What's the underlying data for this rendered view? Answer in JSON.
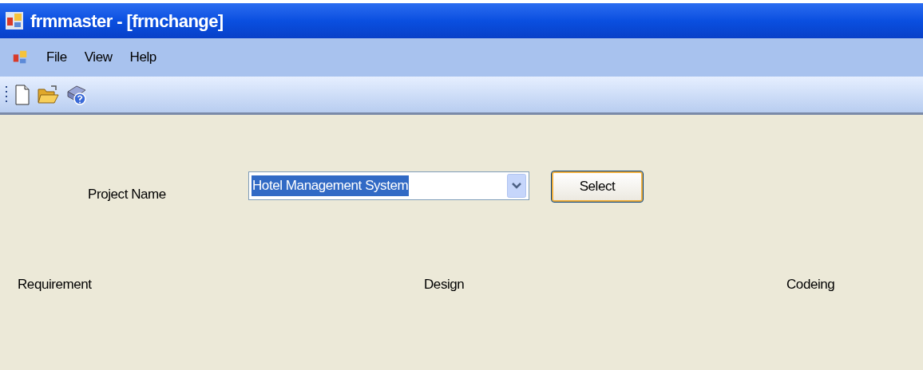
{
  "window": {
    "title": "frmmaster - [frmchange]"
  },
  "menu": [
    {
      "label": "File"
    },
    {
      "label": "View"
    },
    {
      "label": "Help"
    }
  ],
  "toolbar": [
    {
      "kind": "new"
    },
    {
      "kind": "open"
    },
    {
      "kind": "help"
    }
  ],
  "form": {
    "project_label": "Project Name",
    "project_combo": {
      "value": "Hotel Management System",
      "text_selected": true
    },
    "select_button": {
      "label": "Select",
      "focused": true
    },
    "phases": [
      {
        "label": "Requirement"
      },
      {
        "label": "Design"
      },
      {
        "label": "Codeing"
      }
    ]
  }
}
